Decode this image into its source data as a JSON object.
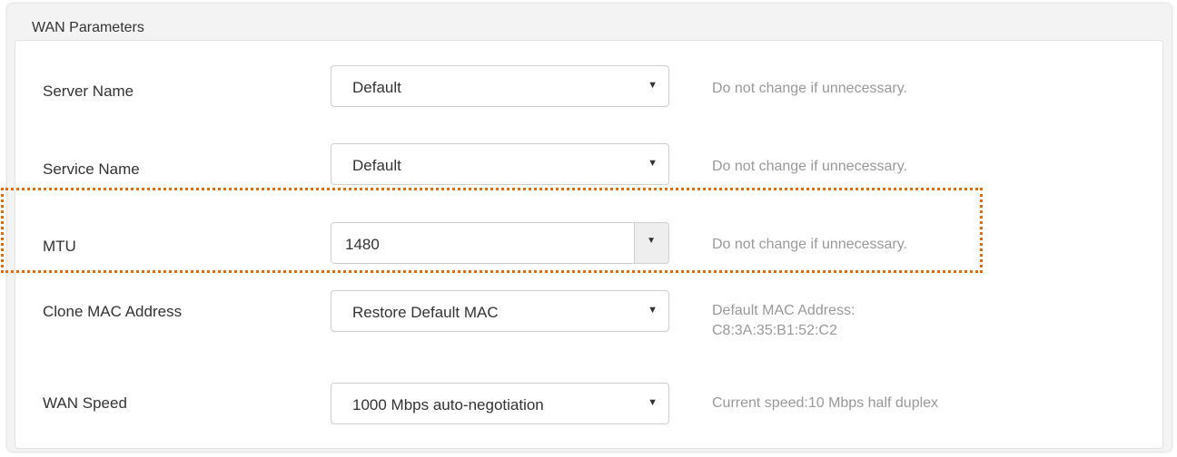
{
  "panel": {
    "title": "WAN Parameters"
  },
  "rows": [
    {
      "label": "Server Name",
      "value": "Default",
      "hint": "Do not change if unnecessary."
    },
    {
      "label": "Service Name",
      "value": "Default",
      "hint": "Do not change if unnecessary."
    },
    {
      "label": "MTU",
      "value": "1480",
      "hint": "Do not change if unnecessary."
    },
    {
      "label": "Clone MAC Address",
      "value": "Restore Default MAC",
      "hint_line1": "Default MAC Address:",
      "hint_line2": "C8:3A:35:B1:52:C2"
    },
    {
      "label": "WAN Speed",
      "value": "1000 Mbps auto-negotiation",
      "hint": "Current speed:10 Mbps half duplex"
    }
  ],
  "colors": {
    "highlight": "#e36c0a",
    "hint": "#999999",
    "panel_bg": "#f3f3f3"
  },
  "icons": {
    "dropdown": "caret-down-icon"
  }
}
